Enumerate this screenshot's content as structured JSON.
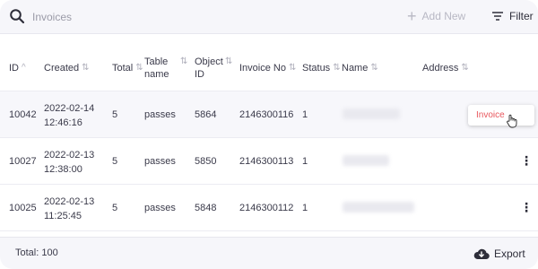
{
  "toolbar": {
    "search_placeholder": "Invoices",
    "add_new_label": "Add New",
    "filter_label": "Filter"
  },
  "table": {
    "headers": {
      "id": "ID",
      "created": "Created",
      "total": "Total",
      "table_name_1": "Table",
      "table_name_2": "name",
      "object_id_1": "Object",
      "object_id_2": "ID",
      "invoice_no": "Invoice No",
      "status": "Status",
      "name": "Name",
      "address": "Address"
    },
    "rows": [
      {
        "id": "10042",
        "created_date": "2022-02-14",
        "created_time": "12:46:16",
        "total": "5",
        "table_name": "passes",
        "object_id": "5864",
        "invoice_no": "2146300116",
        "status": "1"
      },
      {
        "id": "10027",
        "created_date": "2022-02-13",
        "created_time": "12:38:00",
        "total": "5",
        "table_name": "passes",
        "object_id": "5850",
        "invoice_no": "2146300113",
        "status": "1"
      },
      {
        "id": "10025",
        "created_date": "2022-02-13",
        "created_time": "11:25:45",
        "total": "5",
        "table_name": "passes",
        "object_id": "5848",
        "invoice_no": "2146300112",
        "status": "1"
      }
    ],
    "row_menu_item": "Invoice"
  },
  "footer": {
    "total_label": "Total: 100",
    "export_label": "Export"
  },
  "colors": {
    "accent_red": "#e8575d",
    "toolbar_bg": "#f6f6fa"
  }
}
